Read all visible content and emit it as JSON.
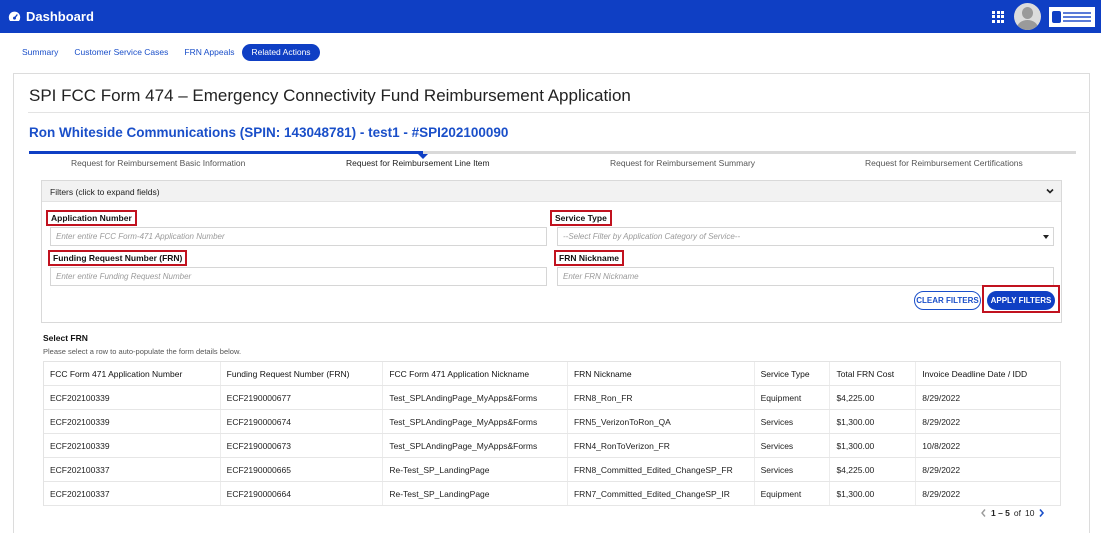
{
  "topbar": {
    "title": "Dashboard"
  },
  "subnav": {
    "items": [
      {
        "label": "Summary"
      },
      {
        "label": "Customer Service Cases"
      },
      {
        "label": "FRN Appeals"
      },
      {
        "label": "Related Actions"
      }
    ]
  },
  "page": {
    "title": "SPI FCC Form 474 – Emergency Connectivity Fund Reimbursement Application",
    "subtitle": "Ron Whiteside Communications (SPIN: 143048781) - test1 - #SPI202100090"
  },
  "steps": [
    {
      "label": "Request for Reimbursement Basic Information"
    },
    {
      "label": "Request for Reimbursement Line Item"
    },
    {
      "label": "Request for Reimbursement Summary"
    },
    {
      "label": "Request for Reimbursement Certifications"
    }
  ],
  "filters": {
    "header": "Filters (click to expand fields)",
    "application_number": {
      "label": "Application Number",
      "placeholder": "Enter entire FCC Form-471 Application Number"
    },
    "service_type": {
      "label": "Service Type",
      "placeholder": "--Select Filter by Application Category of Service--"
    },
    "frn": {
      "label": "Funding Request Number (FRN)",
      "placeholder": "Enter entire Funding Request Number"
    },
    "frn_nickname": {
      "label": "FRN Nickname",
      "placeholder": "Enter FRN Nickname"
    },
    "clear_label": "CLEAR FILTERS",
    "apply_label": "APPLY FILTERS"
  },
  "select_frn": {
    "title": "Select FRN",
    "subtitle": "Please select a row to auto-populate the form details below."
  },
  "table": {
    "columns": [
      "FCC Form 471 Application Number",
      "Funding Request Number (FRN)",
      "FCC Form 471 Application Nickname",
      "FRN Nickname",
      "Service Type",
      "Total FRN Cost",
      "Invoice Deadline Date / IDD"
    ],
    "rows": [
      [
        "ECF202100339",
        "ECF2190000677",
        "Test_SPLAndingPage_MyApps&Forms",
        "FRN8_Ron_FR",
        "Equipment",
        "$4,225.00",
        "8/29/2022"
      ],
      [
        "ECF202100339",
        "ECF2190000674",
        "Test_SPLAndingPage_MyApps&Forms",
        "FRN5_VerizonToRon_QA",
        "Services",
        "$1,300.00",
        "8/29/2022"
      ],
      [
        "ECF202100339",
        "ECF2190000673",
        "Test_SPLAndingPage_MyApps&Forms",
        "FRN4_RonToVerizon_FR",
        "Services",
        "$1,300.00",
        "10/8/2022"
      ],
      [
        "ECF202100337",
        "ECF2190000665",
        "Re-Test_SP_LandingPage",
        "FRN8_Committed_Edited_ChangeSP_FR",
        "Services",
        "$4,225.00",
        "8/29/2022"
      ],
      [
        "ECF202100337",
        "ECF2190000664",
        "Re-Test_SP_LandingPage",
        "FRN7_Committed_Edited_ChangeSP_IR",
        "Equipment",
        "$1,300.00",
        "8/29/2022"
      ]
    ]
  },
  "pager": {
    "range": "1 – 5",
    "of_label": "of",
    "total": "10"
  },
  "colors": {
    "brand": "#0f3fc4",
    "link": "#1a4fc9",
    "highlight": "#c1121f"
  },
  "icons": [
    "dashboard-icon",
    "apps-grid-icon",
    "avatar",
    "usac-logo",
    "chevron-down-icon",
    "chevron-left-icon",
    "chevron-right-icon"
  ]
}
